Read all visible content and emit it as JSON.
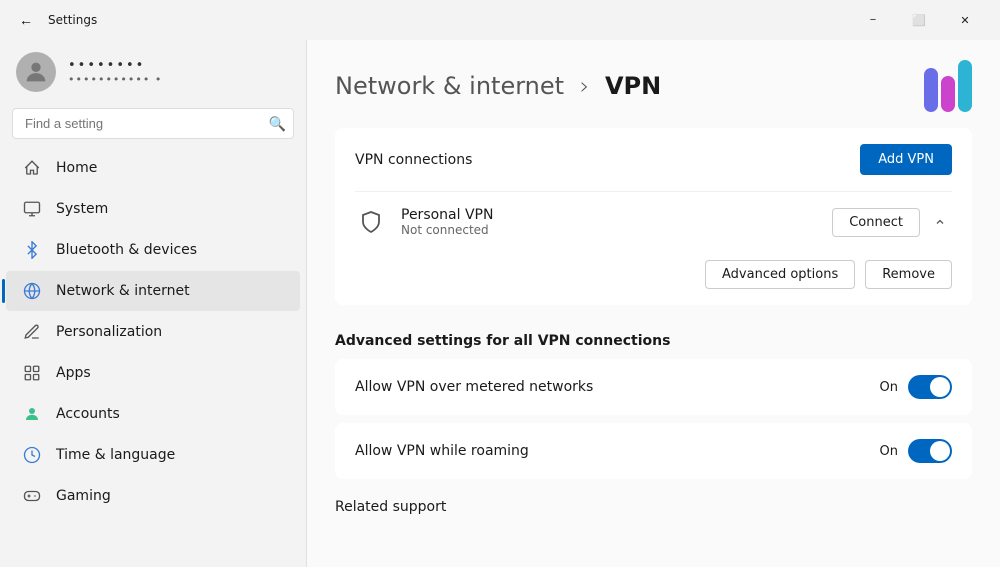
{
  "titleBar": {
    "title": "Settings",
    "minLabel": "−",
    "maxLabel": "⬜",
    "closeLabel": "✕"
  },
  "user": {
    "dots": "••••••••",
    "sub": "•••••••••••  •"
  },
  "search": {
    "placeholder": "Find a setting"
  },
  "nav": [
    {
      "id": "home",
      "icon": "🏠",
      "label": "Home",
      "active": false
    },
    {
      "id": "system",
      "icon": "💻",
      "label": "System",
      "active": false
    },
    {
      "id": "bluetooth",
      "icon": "🔷",
      "label": "Bluetooth & devices",
      "active": false
    },
    {
      "id": "network",
      "icon": "🌐",
      "label": "Network & internet",
      "active": true
    },
    {
      "id": "personalization",
      "icon": "✏️",
      "label": "Personalization",
      "active": false
    },
    {
      "id": "apps",
      "icon": "📦",
      "label": "Apps",
      "active": false
    },
    {
      "id": "accounts",
      "icon": "👤",
      "label": "Accounts",
      "active": false
    },
    {
      "id": "time",
      "icon": "🕐",
      "label": "Time & language",
      "active": false
    },
    {
      "id": "gaming",
      "icon": "🎮",
      "label": "Gaming",
      "active": false
    }
  ],
  "breadcrumb": {
    "parent": "Network & internet",
    "separator": "›",
    "current": "VPN"
  },
  "vpnConnections": {
    "sectionTitle": "VPN connections",
    "addButton": "Add VPN",
    "personalVPN": {
      "name": "Personal VPN",
      "status": "Not connected",
      "connectButton": "Connect",
      "advancedButton": "Advanced options",
      "removeButton": "Remove"
    }
  },
  "advancedSettings": {
    "sectionTitle": "Advanced settings for all VPN connections",
    "options": [
      {
        "label": "Allow VPN over metered networks",
        "state": "On",
        "enabled": true
      },
      {
        "label": "Allow VPN while roaming",
        "state": "On",
        "enabled": true
      }
    ]
  },
  "relatedSupport": {
    "title": "Related support"
  }
}
